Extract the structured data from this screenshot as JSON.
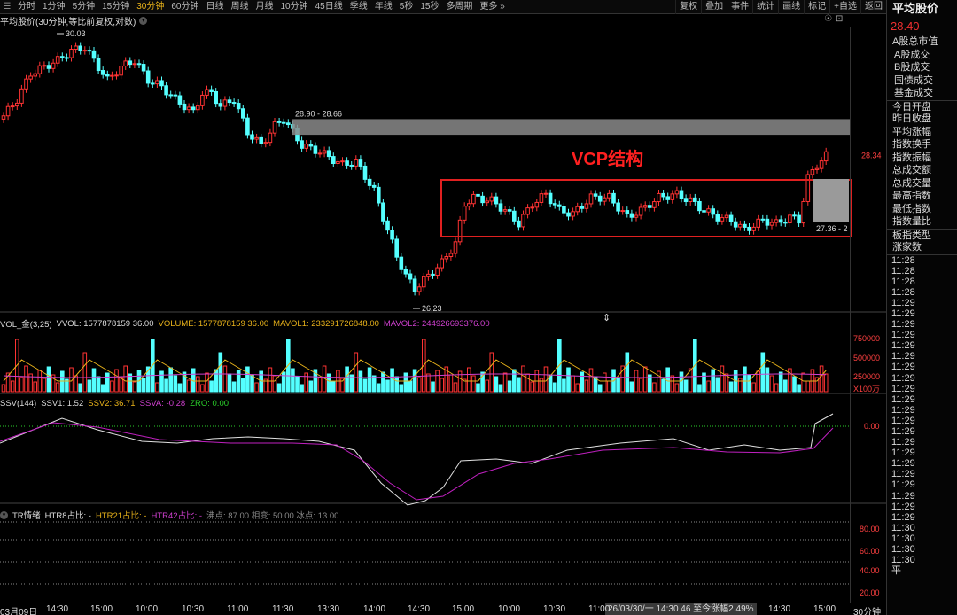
{
  "toolbar": {
    "timeframes": [
      "分时",
      "1分钟",
      "5分钟",
      "15分钟",
      "30分钟",
      "60分钟",
      "日线",
      "周线",
      "月线",
      "10分钟",
      "45日线",
      "季线",
      "年线",
      "5秒",
      "15秒",
      "多周期",
      "更多"
    ],
    "active_timeframe": "30分钟",
    "right_buttons": [
      "复权",
      "叠加",
      "事件",
      "统计",
      "画线",
      "标记",
      "+自选",
      "返回"
    ]
  },
  "chart_title": "平均股价(30分钟,等比前复权,对数)",
  "right_panel": {
    "title": "平均股价",
    "price": "28.40",
    "items": [
      "A股总市值",
      "A股成交",
      "B股成交",
      "国债成交",
      "基金成交",
      "今日开盘",
      "昨日收盘",
      "平均涨幅",
      "指数换手",
      "指数振幅",
      "总成交额",
      "总成交量",
      "最高指数",
      "最低指数",
      "指数量比",
      "板指类型",
      "涨家数"
    ],
    "times": [
      "11:28",
      "11:28",
      "11:28",
      "11:28",
      "11:29",
      "11:29",
      "11:29",
      "11:29",
      "11:29",
      "11:29",
      "11:29",
      "11:29",
      "11:29",
      "11:29",
      "11:29",
      "11:29",
      "11:29",
      "11:29",
      "11:29",
      "11:29",
      "11:29",
      "11:29",
      "11:29",
      "11:29",
      "11:29",
      "11:30",
      "11:30",
      "11:30",
      "11:30"
    ],
    "last_label": "平"
  },
  "price_pane": {
    "high_label": "30.03",
    "low_label": "26.23",
    "resistance_label": "28.90 - 28.66",
    "zone_label": "27.36 - 2",
    "last_price_tag": "28.34",
    "annotation": "VCP结构",
    "colors": {
      "up": "#ff3333",
      "down": "#54ffff",
      "annotation": "#ff2020",
      "box": "#e02020"
    }
  },
  "volume_pane": {
    "label_name": "VOL_金(3,25)",
    "vvol": "VVOL: 1577878159 36.00",
    "volume": "VOLUME: 1577878159 36.00",
    "mavol1": "MAVOL1: 233291726848.00",
    "mavol2": "MAVOL2: 244926693376.00",
    "axis": [
      "750000",
      "500000",
      "250000",
      "X100万"
    ]
  },
  "ssv_pane": {
    "label_name": "SSV(144)",
    "ssv1": "SSV1: 1.52",
    "ssv2": "SSV2: 36.71",
    "ssva": "SSVA: -0.28",
    "zro": "ZRO: 0.00",
    "axis": [
      "0.00"
    ]
  },
  "tr_pane": {
    "label_name": "TR情绪",
    "htr8": "HTR8占比: -",
    "htr21": "HTR21占比: -",
    "htr42": "HTR42占比: -",
    "points": "沸点: 87.00  相变: 50.00  冰点: 13.00",
    "axis": [
      "80.00",
      "60.00",
      "40.00",
      "20.00"
    ]
  },
  "x_axis": {
    "labels": [
      "03月09日",
      "14:30",
      "15:00",
      "10:00",
      "10:30",
      "11:00",
      "11:30",
      "13:30",
      "14:00",
      "14:30",
      "15:00",
      "10:00",
      "10:30",
      "11:00",
      "14:30",
      "15:00"
    ],
    "hover_label": "26/03/30/一 14:30 46 至今涨幅2.49%",
    "period": "30分钟"
  },
  "chart_data": {
    "type": "candlestick",
    "series_up_color": "#ff3333",
    "series_down_color": "#54ffff",
    "annotated_high": 30.03,
    "annotated_low": 26.23,
    "resistance_zone": [
      28.66,
      28.9
    ],
    "last_price": 28.34
  }
}
